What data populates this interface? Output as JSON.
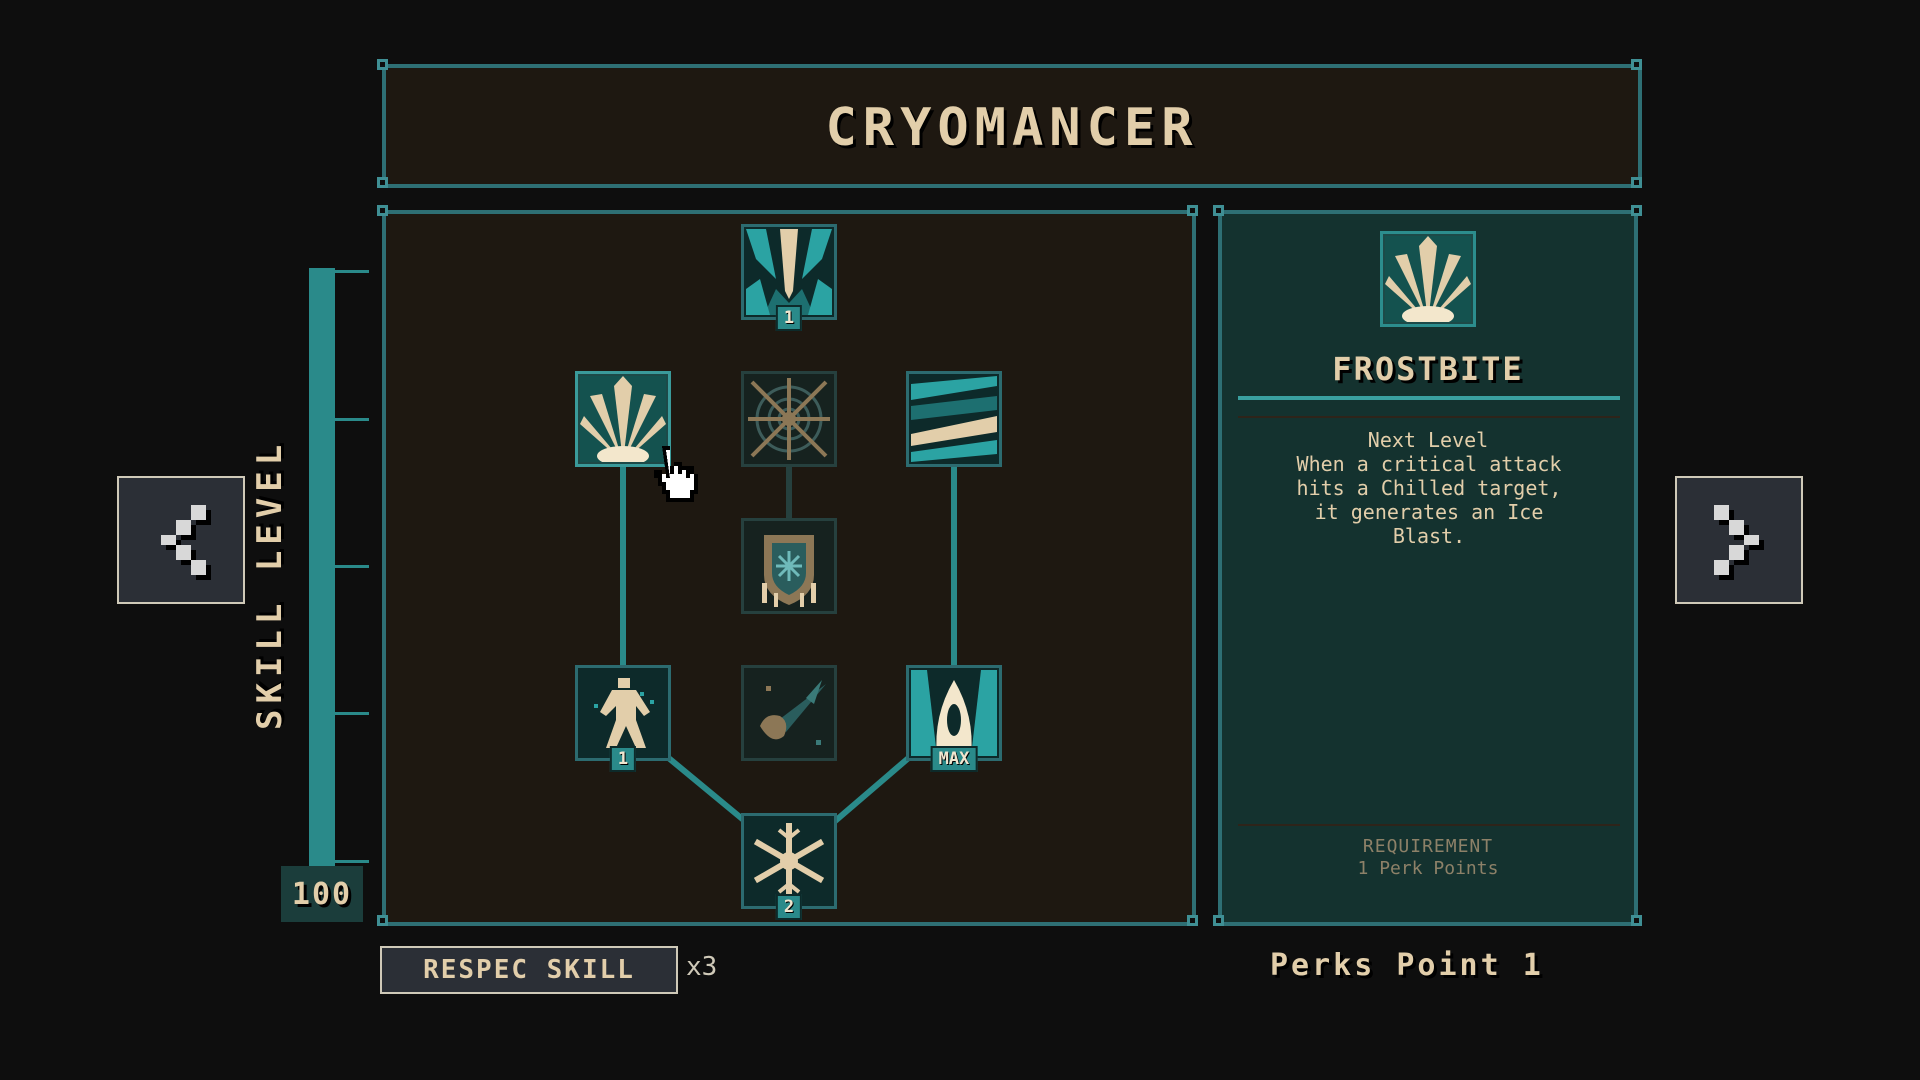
{
  "title": "CRYOMANCER",
  "nav": {
    "prev_icon": "chevron-left-icon",
    "next_icon": "chevron-right-icon"
  },
  "skill_level": {
    "label": "SKILL LEVEL",
    "value": "100",
    "fill_fraction": 1.0
  },
  "colors": {
    "accent": "#2a8a8a",
    "frame": "#2e6f74",
    "panel_dark": "#1e1811",
    "panel_teal": "#14322f",
    "text": "#e2ceaa"
  },
  "tree": {
    "nodes": [
      {
        "id": "top",
        "icon": "frost-spikes-icon",
        "level": "1"
      },
      {
        "id": "frostbite",
        "icon": "ice-burst-icon",
        "level": ""
      },
      {
        "id": "frost-web",
        "icon": "frost-web-icon",
        "level": ""
      },
      {
        "id": "ice-shards",
        "icon": "ice-shards-icon",
        "level": ""
      },
      {
        "id": "frozen-shield",
        "icon": "frozen-shield-icon",
        "level": ""
      },
      {
        "id": "frost-walker",
        "icon": "frost-figure-icon",
        "level": "1"
      },
      {
        "id": "comet",
        "icon": "ice-comet-icon",
        "level": ""
      },
      {
        "id": "ice-prison",
        "icon": "ice-prison-icon",
        "level": "MAX"
      },
      {
        "id": "snowflake",
        "icon": "snowflake-icon",
        "level": "2"
      }
    ]
  },
  "detail": {
    "icon": "ice-burst-icon",
    "name": "FROSTBITE",
    "next_level_label": "Next Level",
    "description": "When a critical attack\nhits a Chilled target,\nit generates an Ice\nBlast.",
    "requirement_label": "REQUIREMENT",
    "requirement_text": "1 Perk Points"
  },
  "respec": {
    "label": "RESPEC SKILL",
    "count": "x3"
  },
  "perks_point": "Perks Point 1"
}
